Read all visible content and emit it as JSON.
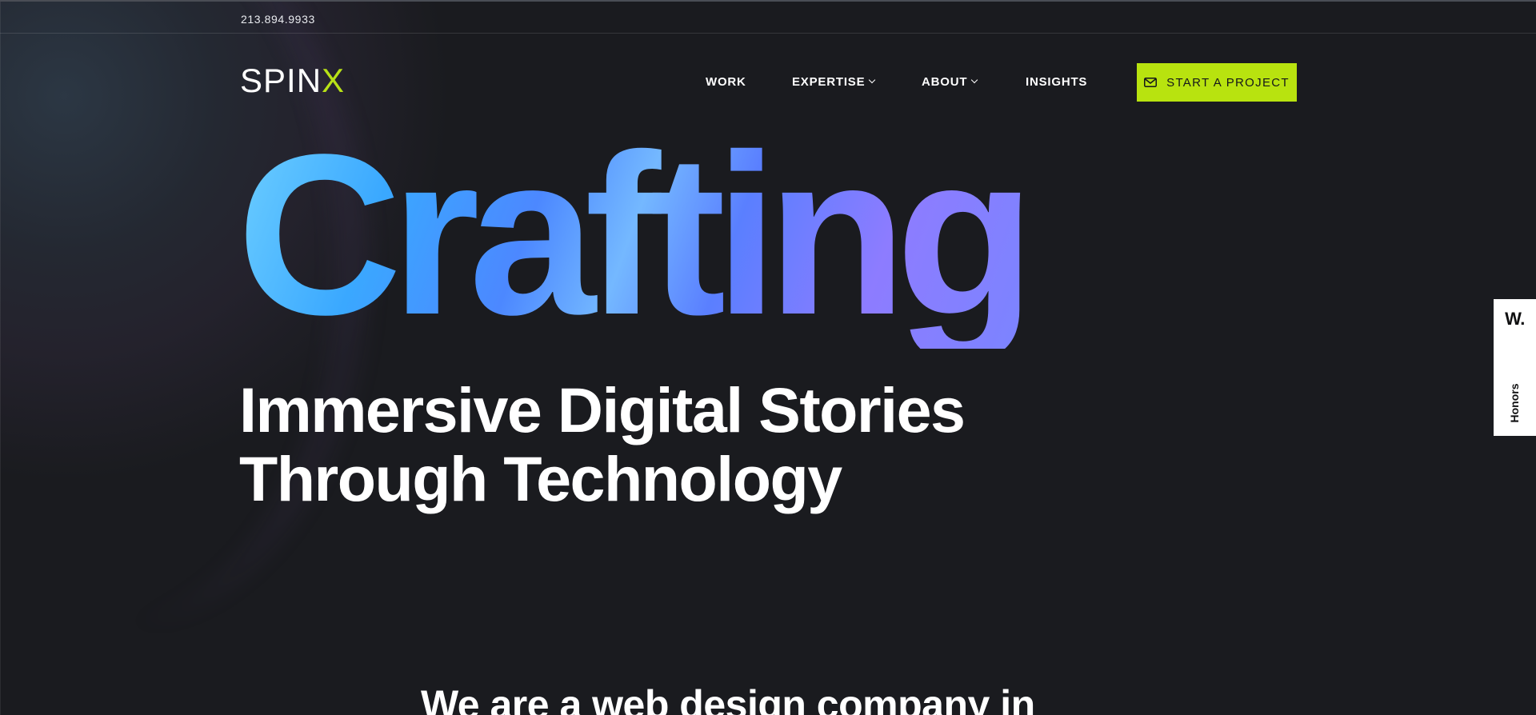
{
  "topbar": {
    "phone": "213.894.9933"
  },
  "brand": {
    "logo_main": "SPIN",
    "logo_accent": "X",
    "accent_color": "#b8e30f"
  },
  "nav": {
    "items": [
      {
        "label": "WORK",
        "has_dropdown": false
      },
      {
        "label": "EXPERTISE",
        "has_dropdown": true
      },
      {
        "label": "ABOUT",
        "has_dropdown": true
      },
      {
        "label": "INSIGHTS",
        "has_dropdown": false
      }
    ],
    "cta_label": "START A PROJECT",
    "cta_icon": "mail-icon"
  },
  "hero": {
    "headline": "Crafting",
    "subline_1": "Immersive Digital Stories",
    "subline_2": "Through Technology"
  },
  "intro": {
    "text": "We are a web design company in"
  },
  "honors_tab": {
    "icon": "W.",
    "label": "Honors"
  },
  "colors": {
    "background": "#1a1b1f",
    "cta_background": "#b8e30f",
    "headline_gradient_start": "#6fd0ff",
    "headline_gradient_end": "#7b84ff"
  }
}
